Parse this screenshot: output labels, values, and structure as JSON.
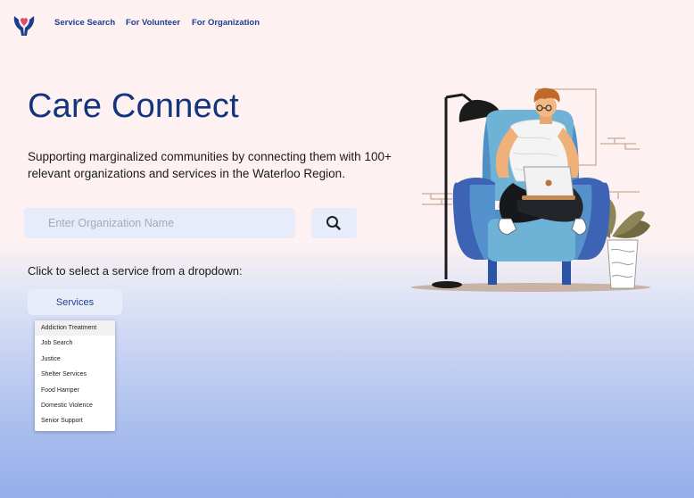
{
  "nav": {
    "logo_icon": "hands-heart-icon",
    "links": [
      "Service Search",
      "For Volunteer",
      "For Organization"
    ]
  },
  "hero": {
    "title": "Care Connect",
    "subtitle": "Supporting marginalized communities by connecting them with 100+ relevant organizations and services in the Waterloo Region.",
    "illustration": "person-on-armchair-with-laptop-illustration"
  },
  "search": {
    "placeholder": "Enter Organization Name",
    "value": "",
    "button_icon": "search-icon"
  },
  "services": {
    "prompt": "Click to select a service from a dropdown:",
    "button_label": "Services",
    "options": [
      "Addiction Treatment",
      "Job Search",
      "Justice",
      "Shelter Services",
      "Food Hamper",
      "Domestic Violence",
      "Senior Support"
    ]
  },
  "colors": {
    "brand": "#1e3d8f",
    "title": "#15347e",
    "input_bg": "#e6ecf9",
    "bg_top": "#fdf2f1",
    "bg_bottom": "#97aeea"
  }
}
